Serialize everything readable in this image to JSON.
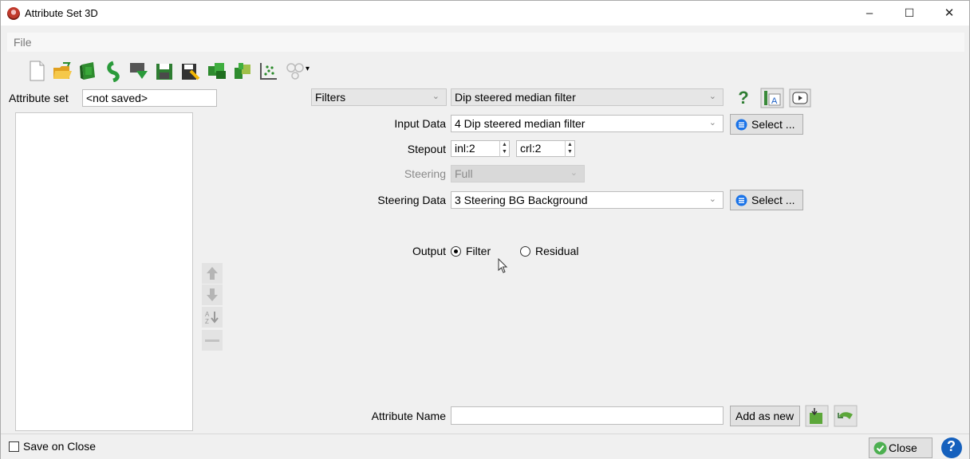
{
  "window": {
    "title": "Attribute Set 3D",
    "minimize": "–",
    "maximize": "☐",
    "close": "✕"
  },
  "menu": {
    "file": "File"
  },
  "toolbar": {
    "icons": [
      "new-file-icon",
      "open-folder-icon",
      "open-default-set-icon",
      "import-icon",
      "reimport-icon",
      "save-icon",
      "save-as-icon",
      "evaluate-icon",
      "evaluate-all-icon",
      "crossplot-icon",
      "link-icon"
    ],
    "dropdown_arrow": "▾"
  },
  "attribute_set": {
    "label": "Attribute set",
    "value": "<not saved>"
  },
  "type_selector": {
    "category": "Filters",
    "method": "Dip steered median filter",
    "help": "?"
  },
  "form": {
    "input_data_label": "Input Data",
    "input_data_value": "4 Dip steered median filter",
    "select_label": "Select ...",
    "stepout_label": "Stepout",
    "stepout_inl": "inl:2",
    "stepout_crl": "crl:2",
    "steering_label": "Steering",
    "steering_value": "Full",
    "steering_data_label": "Steering Data",
    "steering_data_value": "3 Steering BG Background",
    "output_label": "Output",
    "output_filter": "Filter",
    "output_residual": "Residual",
    "output_selected": "Filter"
  },
  "attribute_name": {
    "label": "Attribute Name",
    "value": "",
    "add_as_new": "Add as new"
  },
  "side_buttons": [
    "move-up-icon",
    "move-down-icon",
    "sort-az-icon",
    "remove-icon"
  ],
  "bottom": {
    "save_on_close": "Save on Close",
    "save_on_close_checked": false,
    "close": "Close",
    "help": "?"
  },
  "colors": {
    "accent_blue": "#1a73e8",
    "green": "#4caf50",
    "help_blue": "#1560bd"
  }
}
